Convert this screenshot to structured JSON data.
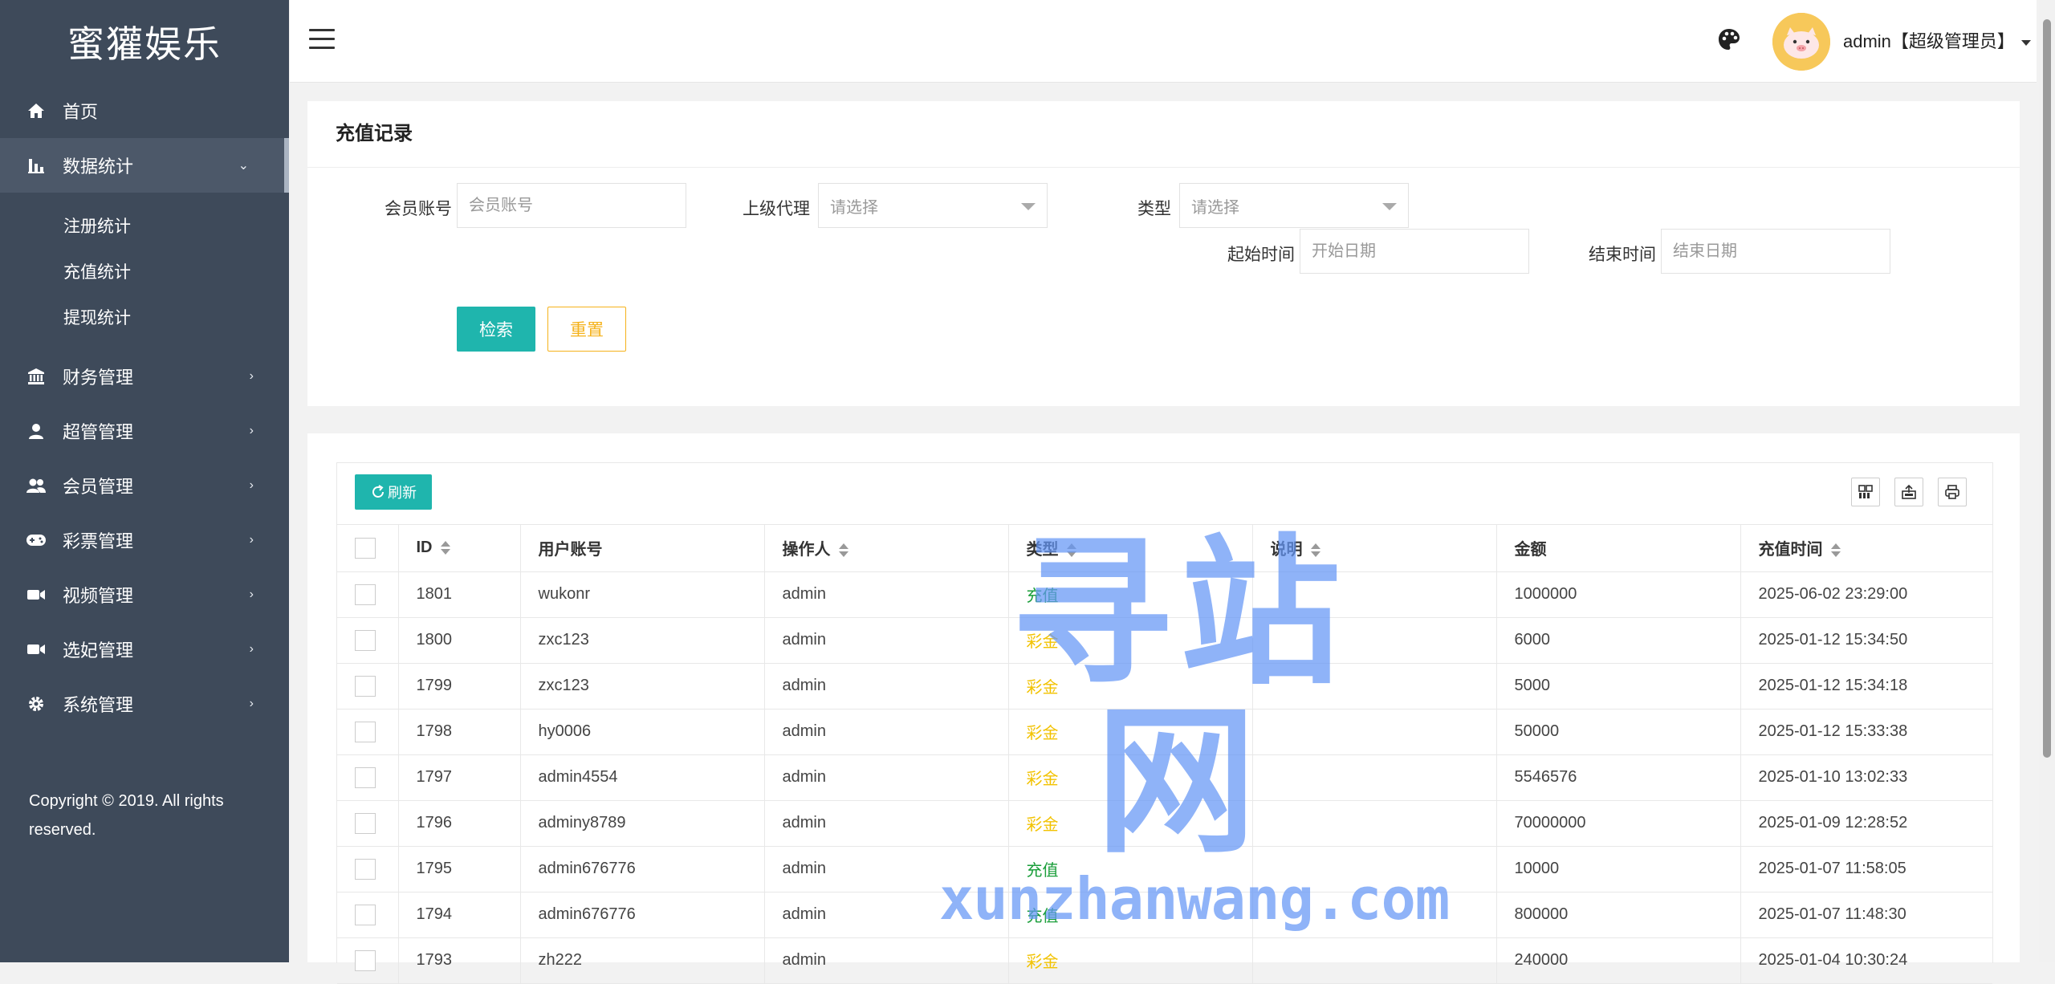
{
  "app": {
    "brand": "蜜獾娱乐"
  },
  "sidebar": {
    "items": [
      {
        "label": "首页",
        "icon": "home-icon"
      },
      {
        "label": "数据统计",
        "icon": "bar-chart-icon",
        "active": true,
        "sub": [
          "注册统计",
          "充值统计",
          "提现统计"
        ]
      },
      {
        "label": "财务管理",
        "icon": "bank-icon"
      },
      {
        "label": "超管管理",
        "icon": "user-icon"
      },
      {
        "label": "会员管理",
        "icon": "users-icon"
      },
      {
        "label": "彩票管理",
        "icon": "gamepad-icon"
      },
      {
        "label": "视频管理",
        "icon": "video-icon"
      },
      {
        "label": "选妃管理",
        "icon": "video-camera-icon"
      },
      {
        "label": "系统管理",
        "icon": "gear-icon"
      }
    ],
    "copyright": "Copyright © 2019. All rights reserved."
  },
  "header": {
    "user_label": "admin【超级管理员】",
    "icons": [
      "menu-icon",
      "palette-icon",
      "avatar"
    ]
  },
  "search": {
    "title": "充值记录",
    "member_label": "会员账号",
    "member_placeholder": "会员账号",
    "agent_label": "上级代理",
    "agent_value": "请选择",
    "type_label": "类型",
    "type_value": "请选择",
    "start_label": "起始时间",
    "start_placeholder": "开始日期",
    "end_label": "结束时间",
    "end_placeholder": "结束日期",
    "search_btn": "检索",
    "reset_btn": "重置"
  },
  "table": {
    "refresh_btn": "刷新",
    "tool_icons": [
      "columns-icon",
      "export-icon",
      "print-icon"
    ],
    "columns": [
      "ID",
      "用户账号",
      "操作人",
      "类型",
      "说明",
      "金额",
      "充值时间"
    ],
    "rows": [
      {
        "id": "1801",
        "account": "wukonr",
        "operator": "admin",
        "type": "充值",
        "type_kind": "recharge",
        "note": "",
        "amount": "1000000",
        "time": "2025-06-02 23:29:00"
      },
      {
        "id": "1800",
        "account": "zxc123",
        "operator": "admin",
        "type": "彩金",
        "type_kind": "bonus",
        "note": "",
        "amount": "6000",
        "time": "2025-01-12 15:34:50"
      },
      {
        "id": "1799",
        "account": "zxc123",
        "operator": "admin",
        "type": "彩金",
        "type_kind": "bonus",
        "note": "",
        "amount": "5000",
        "time": "2025-01-12 15:34:18"
      },
      {
        "id": "1798",
        "account": "hy0006",
        "operator": "admin",
        "type": "彩金",
        "type_kind": "bonus",
        "note": "",
        "amount": "50000",
        "time": "2025-01-12 15:33:38"
      },
      {
        "id": "1797",
        "account": "admin4554",
        "operator": "admin",
        "type": "彩金",
        "type_kind": "bonus",
        "note": "",
        "amount": "5546576",
        "time": "2025-01-10 13:02:33"
      },
      {
        "id": "1796",
        "account": "adminy8789",
        "operator": "admin",
        "type": "彩金",
        "type_kind": "bonus",
        "note": "",
        "amount": "70000000",
        "time": "2025-01-09 12:28:52"
      },
      {
        "id": "1795",
        "account": "admin676776",
        "operator": "admin",
        "type": "充值",
        "type_kind": "recharge",
        "note": "",
        "amount": "10000",
        "time": "2025-01-07 11:58:05"
      },
      {
        "id": "1794",
        "account": "admin676776",
        "operator": "admin",
        "type": "充值",
        "type_kind": "recharge",
        "note": "",
        "amount": "800000",
        "time": "2025-01-07 11:48:30"
      },
      {
        "id": "1793",
        "account": "zh222",
        "operator": "admin",
        "type": "彩金",
        "type_kind": "bonus",
        "note": "",
        "amount": "240000",
        "time": "2025-01-04 10:30:24"
      }
    ]
  },
  "watermark": {
    "big": "寻站网",
    "small": "xunzhanwang.com"
  },
  "colors": {
    "sidebar": "#3e4a5a",
    "accent": "#1fb5ad",
    "reset": "#f5b21b",
    "recharge": "#1a9e3a",
    "bonus": "#f2c200"
  }
}
